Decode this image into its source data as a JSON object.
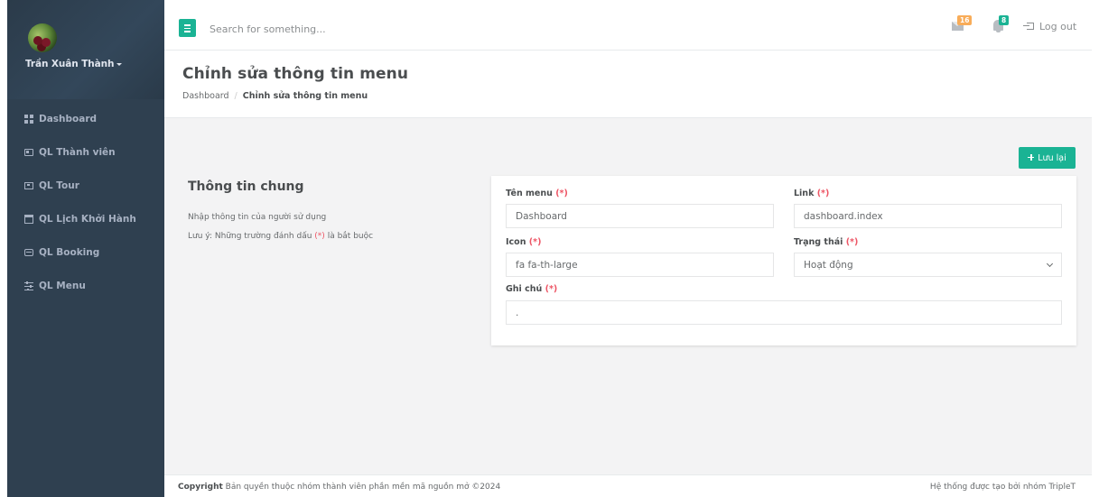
{
  "sidebar": {
    "user_name": "Trần Xuân Thành",
    "items": [
      {
        "label": "Dashboard",
        "icon": "th-large-icon"
      },
      {
        "label": "QL Thành viên",
        "icon": "id-card-icon"
      },
      {
        "label": "QL Tour",
        "icon": "ticket-icon"
      },
      {
        "label": "QL Lịch Khởi Hành",
        "icon": "calendar-icon"
      },
      {
        "label": "QL Booking",
        "icon": "hdd-icon"
      },
      {
        "label": "QL Menu",
        "icon": "sliders-icon"
      }
    ]
  },
  "topbar": {
    "search_placeholder": "Search for something...",
    "mail_count": "16",
    "notification_count": "8",
    "logout_label": "Log out"
  },
  "heading": {
    "title": "Chỉnh sửa thông tin menu",
    "breadcrumb_home": "Dashboard",
    "breadcrumb_sep": "/",
    "breadcrumb_current": "Chỉnh sửa thông tin menu"
  },
  "content": {
    "save_label": "Lưu lại",
    "section_title": "Thông tin chung",
    "section_desc_1": "Nhập thông tin của người sử dụng",
    "section_desc_2_pre": "Lưu ý: Những trường đánh dấu",
    "required_mark": "(*)",
    "section_desc_2_post": "là bắt buộc"
  },
  "form": {
    "name_label": "Tên menu",
    "name_value": "Dashboard",
    "link_label": "Link",
    "link_value": "dashboard.index",
    "icon_label": "Icon",
    "icon_value": "fa fa-th-large",
    "status_label": "Trạng thái",
    "status_value": "Hoạt động",
    "note_label": "Ghi chú",
    "note_value": "."
  },
  "footer": {
    "copyright_bold": "Copyright",
    "copyright_text": "Bản quyền thuộc nhóm thành viên phần mền mã nguồn mở ©2024",
    "right_text": "Hệ thống được tạo bởi nhóm TripleT"
  },
  "colors": {
    "sidebar_bg": "#2f4050",
    "accent": "#1ab394",
    "required": "#ed5565",
    "warning_badge": "#f8ac59"
  }
}
